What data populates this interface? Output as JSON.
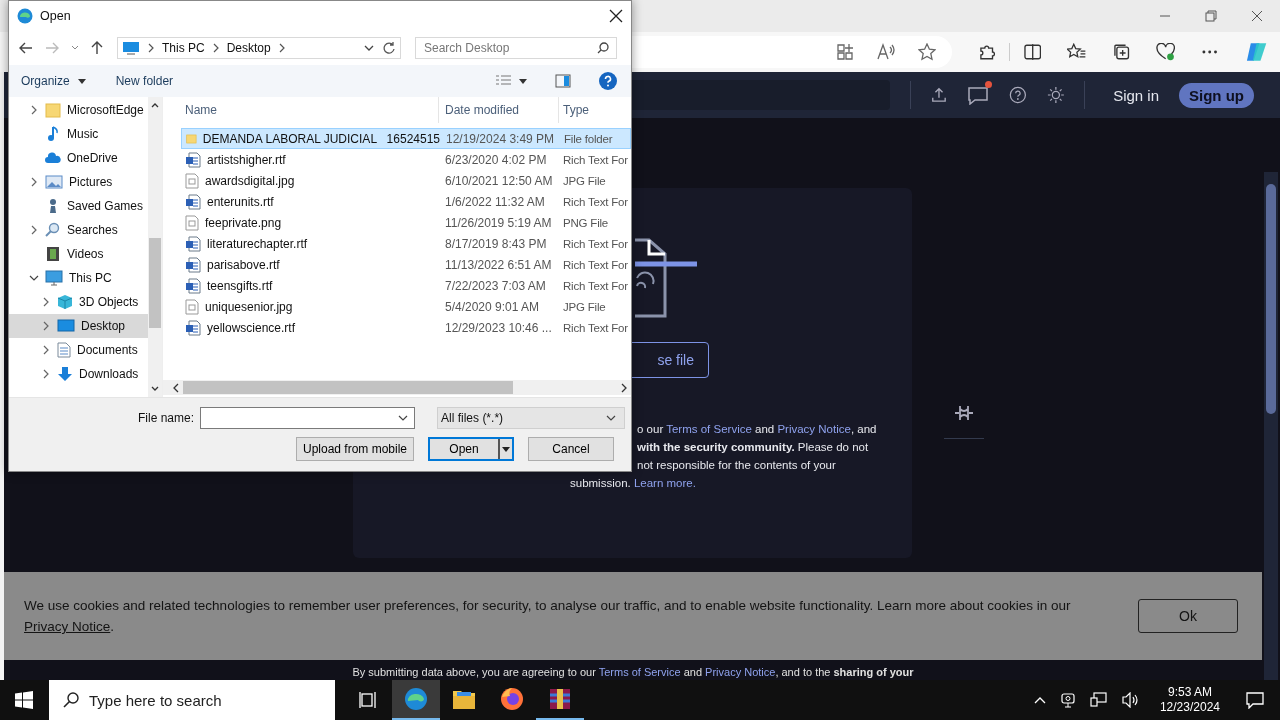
{
  "browser": {
    "header": {
      "sign_in": "Sign in",
      "sign_up": "Sign up",
      "has_notification": true
    },
    "card": {
      "choose_button": "se file",
      "notice_lines": [
        [
          {
            "kind": "plain",
            "text": "o our "
          },
          {
            "kind": "link",
            "text": "Terms of Service"
          },
          {
            "kind": "plain",
            "text": " and "
          },
          {
            "kind": "link",
            "text": "Privacy Notice"
          },
          {
            "kind": "plain",
            "text": ", and"
          }
        ],
        [
          {
            "kind": "bold",
            "text": "with the security community."
          },
          {
            "kind": "plain",
            "text": " Please do not"
          }
        ],
        [
          {
            "kind": "plain",
            "text": "not responsible for the contents of your"
          }
        ],
        [
          {
            "kind": "plain",
            "text": "submission. "
          },
          {
            "kind": "link",
            "text": "Learn more."
          }
        ]
      ]
    },
    "cookie_banner": {
      "text": "We use cookies and related technologies to remember user preferences, for security, to analyse our traffic, and to enable website functionality. Learn more about cookies in our",
      "link": "Privacy Notice",
      "end": ".",
      "button": "Ok"
    },
    "footer": [
      {
        "kind": "plain",
        "text": "By submitting data above, you are agreeing to our "
      },
      {
        "kind": "link",
        "text": "Terms of Service"
      },
      {
        "kind": "plain",
        "text": " and "
      },
      {
        "kind": "link",
        "text": "Privacy Notice"
      },
      {
        "kind": "plain",
        "text": ", and to the "
      },
      {
        "kind": "bold",
        "text": "sharing of your"
      }
    ]
  },
  "dialog": {
    "title": "Open",
    "path": [
      "This PC",
      "Desktop"
    ],
    "search": {
      "placeholder": "Search Desktop"
    },
    "commands": [
      "Organize",
      "New folder"
    ],
    "nav": [
      {
        "label": "MicrosoftEdge",
        "kind": "folder",
        "expanded": false,
        "selected": false
      },
      {
        "label": "Music",
        "kind": "music",
        "selected": false
      },
      {
        "label": "OneDrive",
        "kind": "cloud",
        "selected": false
      },
      {
        "label": "Pictures",
        "kind": "pictures",
        "expanded": false,
        "selected": false
      },
      {
        "label": "Saved Games",
        "kind": "games",
        "selected": false
      },
      {
        "label": "Searches",
        "kind": "search",
        "expanded": false,
        "selected": false
      },
      {
        "label": "Videos",
        "kind": "videos",
        "selected": false
      },
      {
        "label": "This PC",
        "kind": "pc",
        "expanded": true,
        "selected": false,
        "children": [
          {
            "label": "3D Objects",
            "kind": "cube",
            "expanded": false,
            "selected": false
          },
          {
            "label": "Desktop",
            "kind": "desktop",
            "expanded": false,
            "selected": true
          },
          {
            "label": "Documents",
            "kind": "documents",
            "expanded": false,
            "selected": false
          },
          {
            "label": "Downloads",
            "kind": "downloads",
            "expanded": false,
            "selected": false
          }
        ]
      }
    ],
    "columns": [
      "Name",
      "Date modified",
      "Type"
    ],
    "files": [
      {
        "name": "DEMANDA LABORAL JUDICIAL   16524515",
        "date": "12/19/2024 3:49 PM",
        "type": "File folder",
        "kind": "folder",
        "selected": true
      },
      {
        "name": "artistshigher.rtf",
        "date": "6/23/2020 4:02 PM",
        "type": "Rich Text For",
        "kind": "rtf",
        "selected": false
      },
      {
        "name": "awardsdigital.jpg",
        "date": "6/10/2021 12:50 AM",
        "type": "JPG File",
        "kind": "image",
        "selected": false
      },
      {
        "name": "enterunits.rtf",
        "date": "1/6/2022 11:32 AM",
        "type": "Rich Text For",
        "kind": "rtf",
        "selected": false
      },
      {
        "name": "feeprivate.png",
        "date": "11/26/2019 5:19 AM",
        "type": "PNG File",
        "kind": "image",
        "selected": false
      },
      {
        "name": "literaturechapter.rtf",
        "date": "8/17/2019 8:43 PM",
        "type": "Rich Text For",
        "kind": "rtf",
        "selected": false
      },
      {
        "name": "parisabove.rtf",
        "date": "11/13/2022 6:51 AM",
        "type": "Rich Text For",
        "kind": "rtf",
        "selected": false
      },
      {
        "name": "teensgifts.rtf",
        "date": "7/22/2023 7:03 AM",
        "type": "Rich Text For",
        "kind": "rtf",
        "selected": false
      },
      {
        "name": "uniquesenior.jpg",
        "date": "5/4/2020 9:01 AM",
        "type": "JPG File",
        "kind": "image",
        "selected": false
      },
      {
        "name": "yellowscience.rtf",
        "date": "12/29/2023 10:46 ...",
        "type": "Rich Text For",
        "kind": "rtf",
        "selected": false
      }
    ],
    "file_name_label": "File name:",
    "filter": "All files (*.*)",
    "buttons": [
      "Upload from mobile",
      "Open",
      "Cancel"
    ]
  },
  "taskbar": {
    "search": {
      "placeholder": "Type here to search"
    },
    "apps": [
      {
        "kind": "edge",
        "selected": true,
        "running": true
      },
      {
        "kind": "explorer",
        "selected": false,
        "running": false
      },
      {
        "kind": "firefox",
        "selected": false,
        "running": false
      },
      {
        "kind": "archive",
        "selected": false,
        "running": true
      }
    ],
    "time": "9:53 AM",
    "date": "12/23/2024"
  }
}
